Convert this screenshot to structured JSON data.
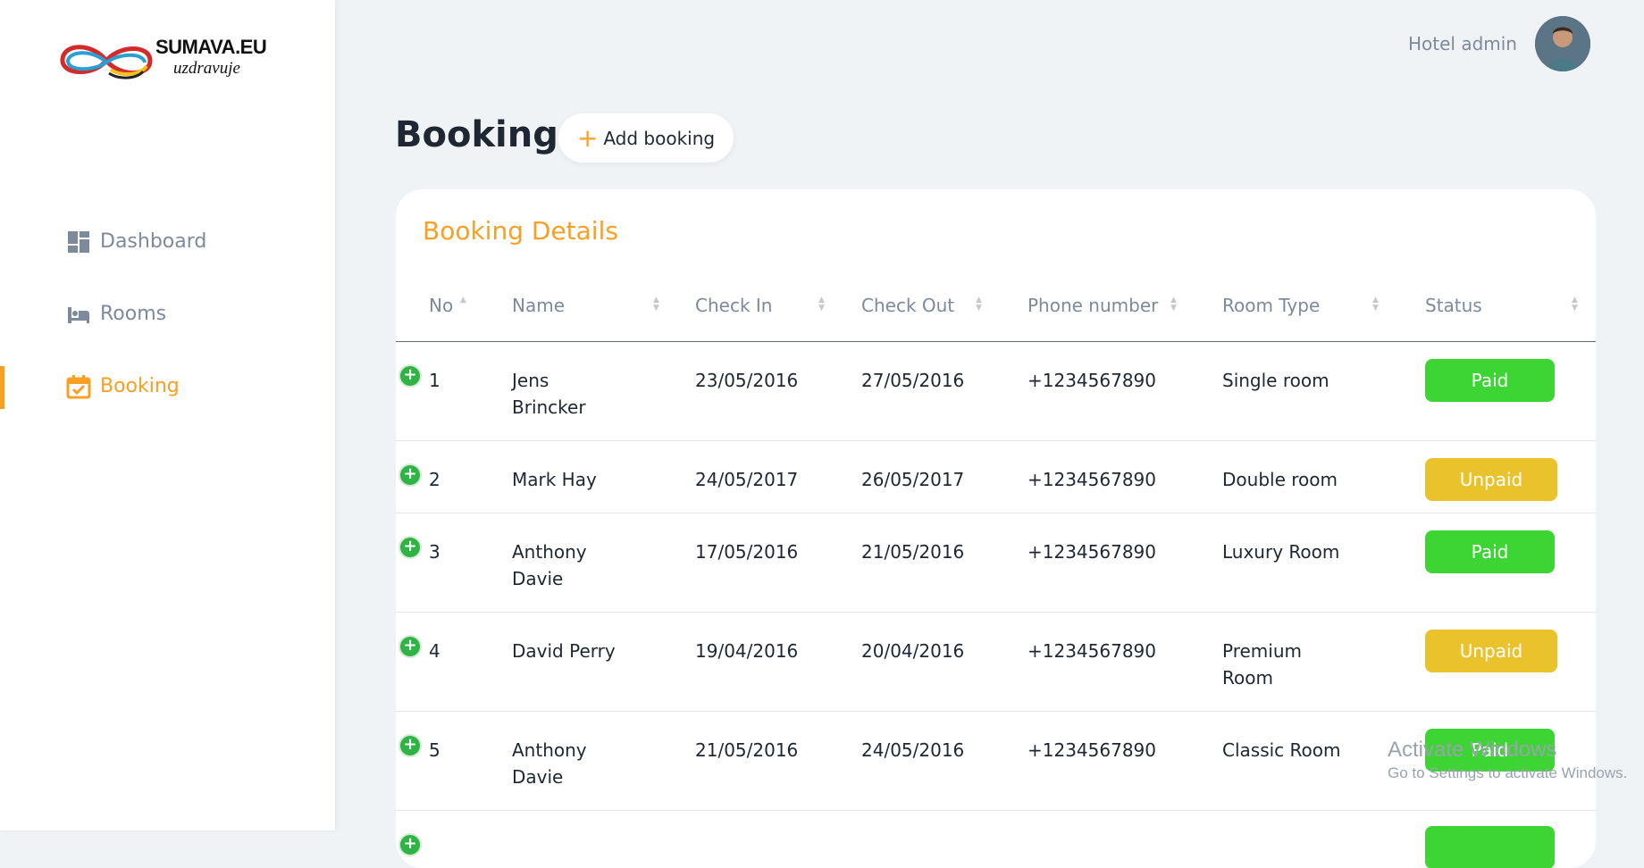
{
  "brand": {
    "name": "SUMAVA.EU",
    "tagline": "uzdravuje"
  },
  "sidebar": {
    "items": [
      {
        "label": "Dashboard",
        "icon": "dashboard-icon"
      },
      {
        "label": "Rooms",
        "icon": "bed-icon"
      },
      {
        "label": "Booking",
        "icon": "calendar-check-icon",
        "active": true
      }
    ]
  },
  "user": {
    "name": "Hotel admin"
  },
  "page": {
    "title": "Booking",
    "add_button": "Add booking"
  },
  "card": {
    "title": "Booking Details"
  },
  "table": {
    "columns": [
      "No",
      "Name",
      "Check In",
      "Check Out",
      "Phone number",
      "Room Type",
      "Status"
    ],
    "rows": [
      {
        "no": "1",
        "name": [
          "Jens",
          "Brincker"
        ],
        "check_in": "23/05/2016",
        "check_out": "27/05/2016",
        "phone": "+1234567890",
        "room_type": [
          "Single room"
        ],
        "status": "Paid"
      },
      {
        "no": "2",
        "name": [
          "Mark Hay"
        ],
        "check_in": "24/05/2017",
        "check_out": "26/05/2017",
        "phone": "+1234567890",
        "room_type": [
          "Double room"
        ],
        "status": "Unpaid"
      },
      {
        "no": "3",
        "name": [
          "Anthony",
          "Davie"
        ],
        "check_in": "17/05/2016",
        "check_out": "21/05/2016",
        "phone": "+1234567890",
        "room_type": [
          "Luxury Room"
        ],
        "status": "Paid"
      },
      {
        "no": "4",
        "name": [
          "David Perry"
        ],
        "check_in": "19/04/2016",
        "check_out": "20/04/2016",
        "phone": "+1234567890",
        "room_type": [
          "Premium",
          "Room"
        ],
        "status": "Unpaid"
      },
      {
        "no": "5",
        "name": [
          "Anthony",
          "Davie"
        ],
        "check_in": "21/05/2016",
        "check_out": "24/05/2016",
        "phone": "+1234567890",
        "room_type": [
          "Classic Room"
        ],
        "status": "Paid"
      }
    ]
  },
  "watermark": {
    "line1": "Activate Windows",
    "line2": "Go to Settings to activate Windows."
  },
  "colors": {
    "accent": "#f7a023",
    "paid": "#3dd534",
    "unpaid": "#eac22c",
    "expand": "#2fb344"
  }
}
